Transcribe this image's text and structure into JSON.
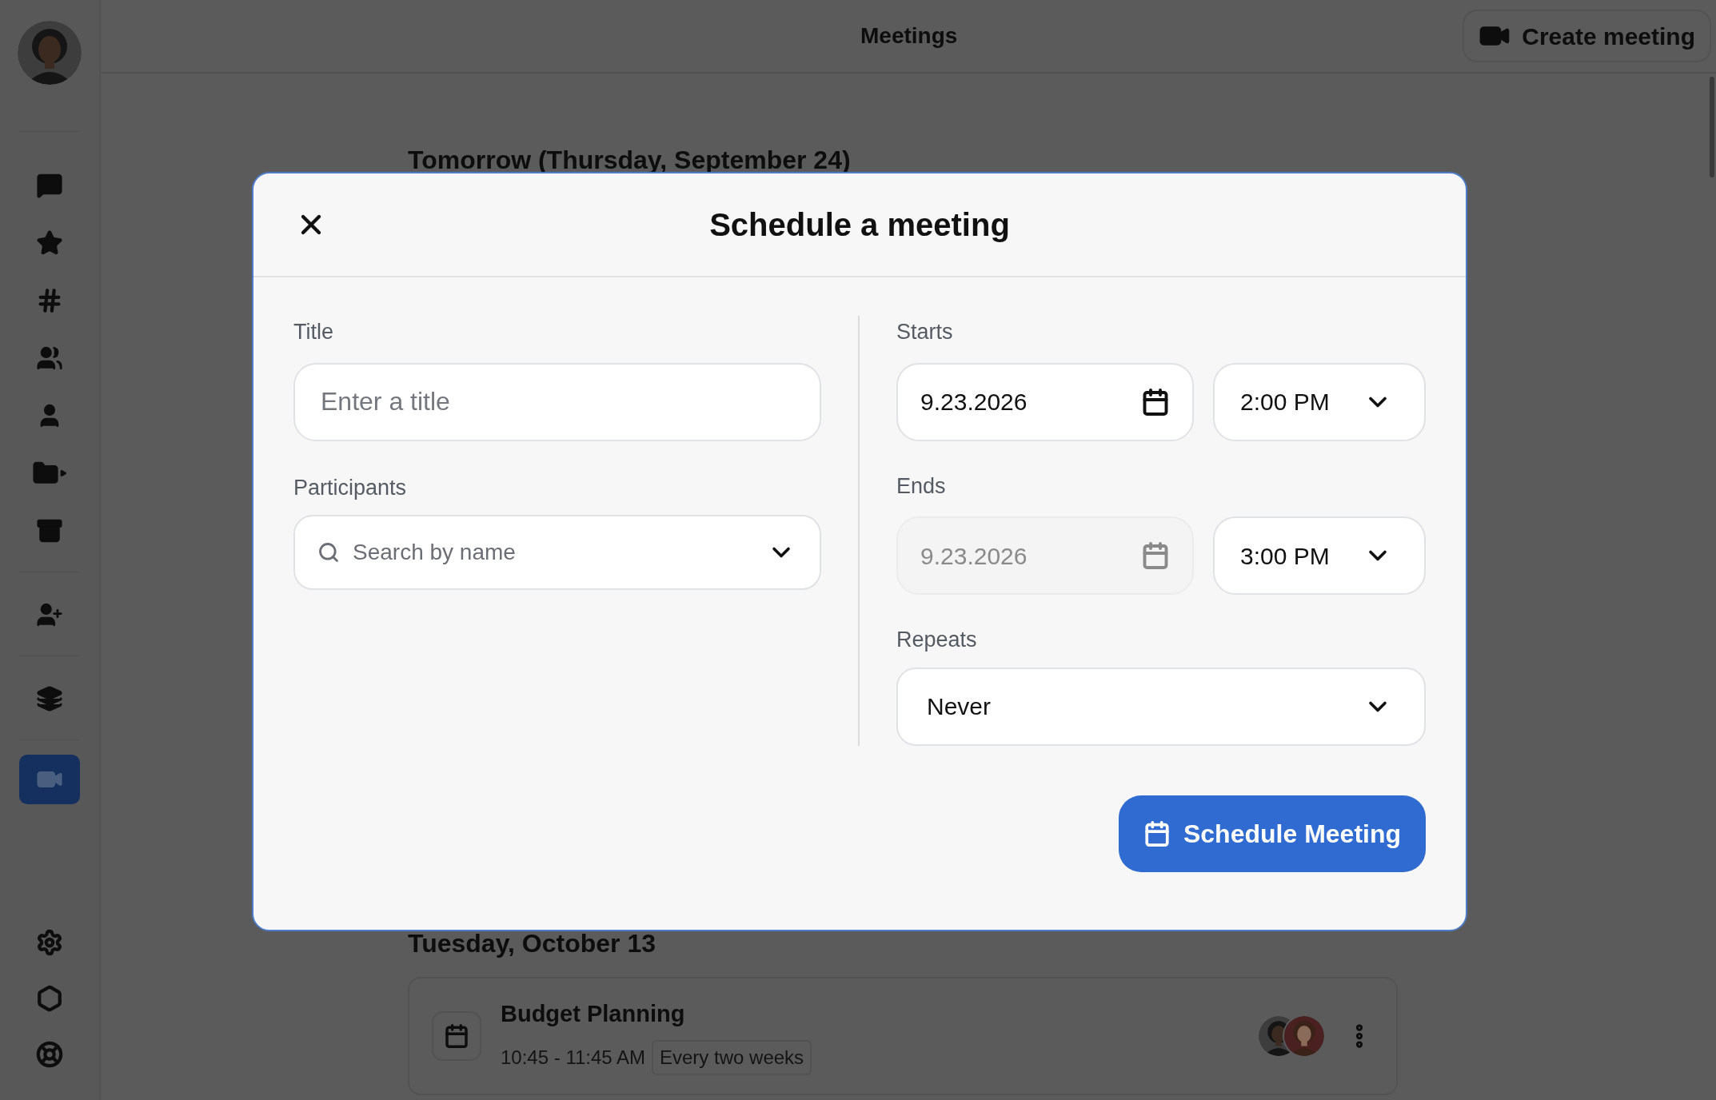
{
  "header": {
    "title": "Meetings",
    "create_button": "Create meeting"
  },
  "nav_items": [
    {
      "selected": false
    },
    {
      "selected": false
    },
    {
      "selected": false
    },
    {
      "selected": false
    },
    {
      "selected": false
    },
    {
      "selected": false
    },
    {
      "selected": false
    },
    {
      "selected": false
    },
    {
      "selected": false
    },
    {
      "selected": true
    },
    {
      "selected": false
    },
    {
      "selected": false
    },
    {
      "selected": false
    }
  ],
  "sections": [
    {
      "heading": "Tomorrow (Thursday, September 24)"
    },
    {
      "heading": "Tuesday, October 13",
      "meetings": [
        {
          "title": "Budget Planning",
          "time": "10:45 - 11:45 AM",
          "recurrence": "Every two weeks"
        }
      ]
    }
  ],
  "dialog": {
    "title": "Schedule a meeting",
    "title_field": {
      "label": "Title",
      "placeholder": "Enter a title"
    },
    "participants_field": {
      "label": "Participants",
      "placeholder": "Search by name"
    },
    "starts": {
      "label": "Starts",
      "date": "9.23.2026",
      "date_disabled": false,
      "time": "2:00 PM"
    },
    "ends": {
      "label": "Ends",
      "date": "9.23.2026",
      "date_disabled": true,
      "time": "3:00 PM"
    },
    "repeats": {
      "label": "Repeats",
      "value": "Never"
    },
    "submit_button": "Schedule Meeting"
  }
}
